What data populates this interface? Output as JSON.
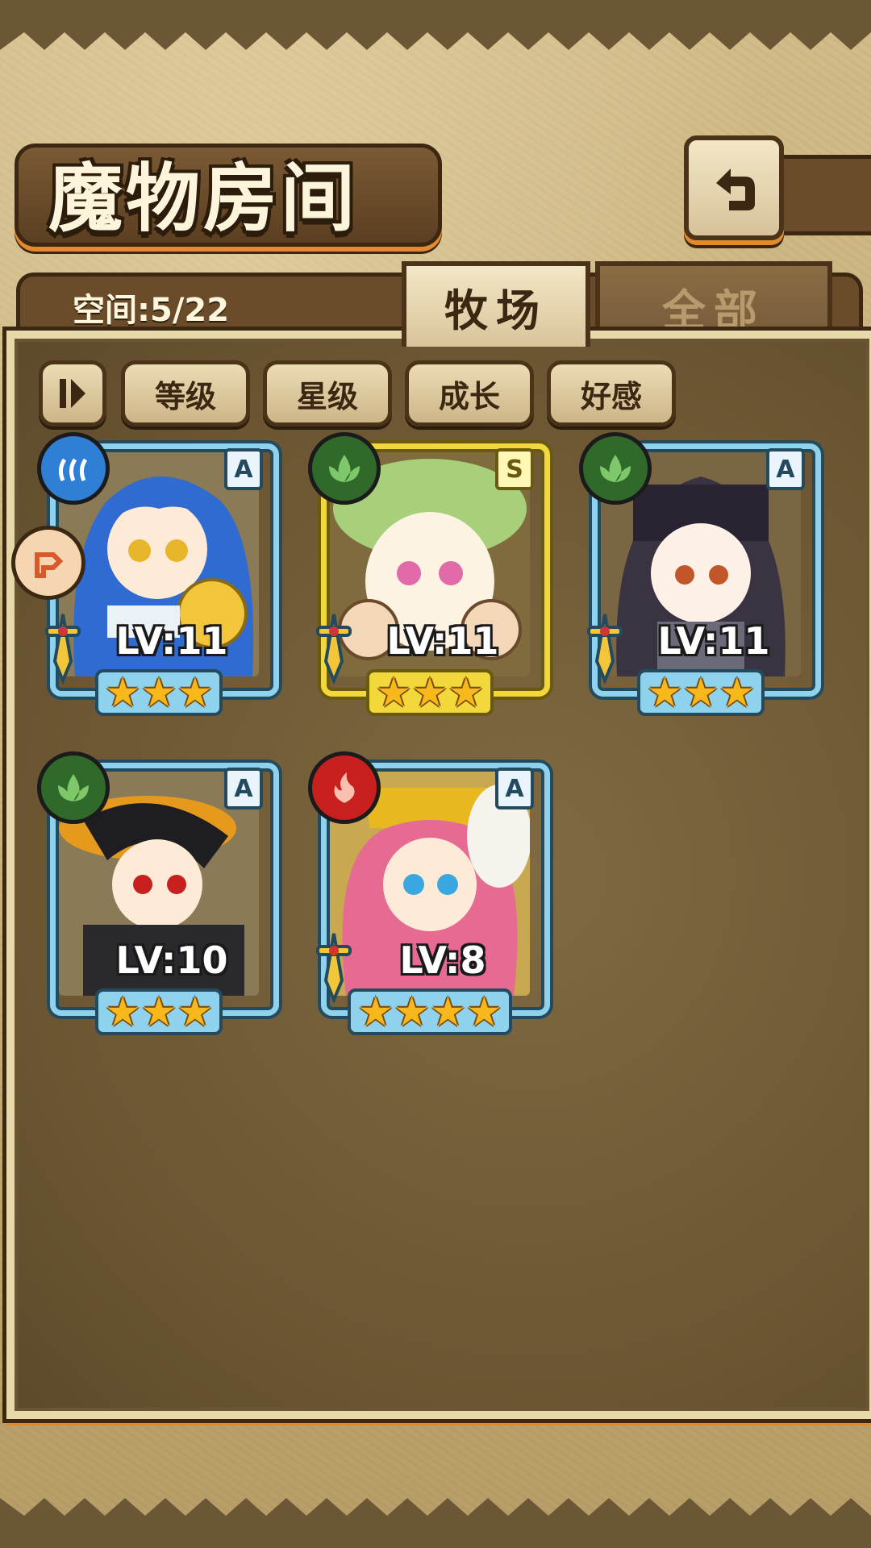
{
  "header": {
    "title": "魔物房间",
    "back_icon": "return-icon"
  },
  "tabs": {
    "space_text": "空间:5/22",
    "items": [
      {
        "label": "牧场",
        "active": true
      },
      {
        "label": "全部",
        "active": false
      }
    ]
  },
  "sort": {
    "toggle_icon": "sort-direction-icon",
    "buttons": [
      "等级",
      "星级",
      "成长",
      "好感"
    ]
  },
  "monsters": [
    {
      "level": "LV:11",
      "rank": "A",
      "element": "water",
      "stars": 3,
      "frame": "blue",
      "has_sword": true,
      "locked": true
    },
    {
      "level": "LV:11",
      "rank": "S",
      "element": "wood",
      "stars": 3,
      "frame": "gold",
      "has_sword": true,
      "locked": false
    },
    {
      "level": "LV:11",
      "rank": "A",
      "element": "wood",
      "stars": 3,
      "frame": "blue",
      "has_sword": true,
      "locked": false
    },
    {
      "level": "LV:10",
      "rank": "A",
      "element": "wood",
      "stars": 3,
      "frame": "blue",
      "has_sword": false,
      "locked": false
    },
    {
      "level": "LV:8",
      "rank": "A",
      "element": "fire",
      "stars": 4,
      "frame": "blue",
      "has_sword": true,
      "locked": false
    }
  ],
  "colors": {
    "water": "#2f7fd6",
    "wood": "#2f6a2a",
    "fire": "#c8201e",
    "accent_orange": "#e38a2a"
  }
}
